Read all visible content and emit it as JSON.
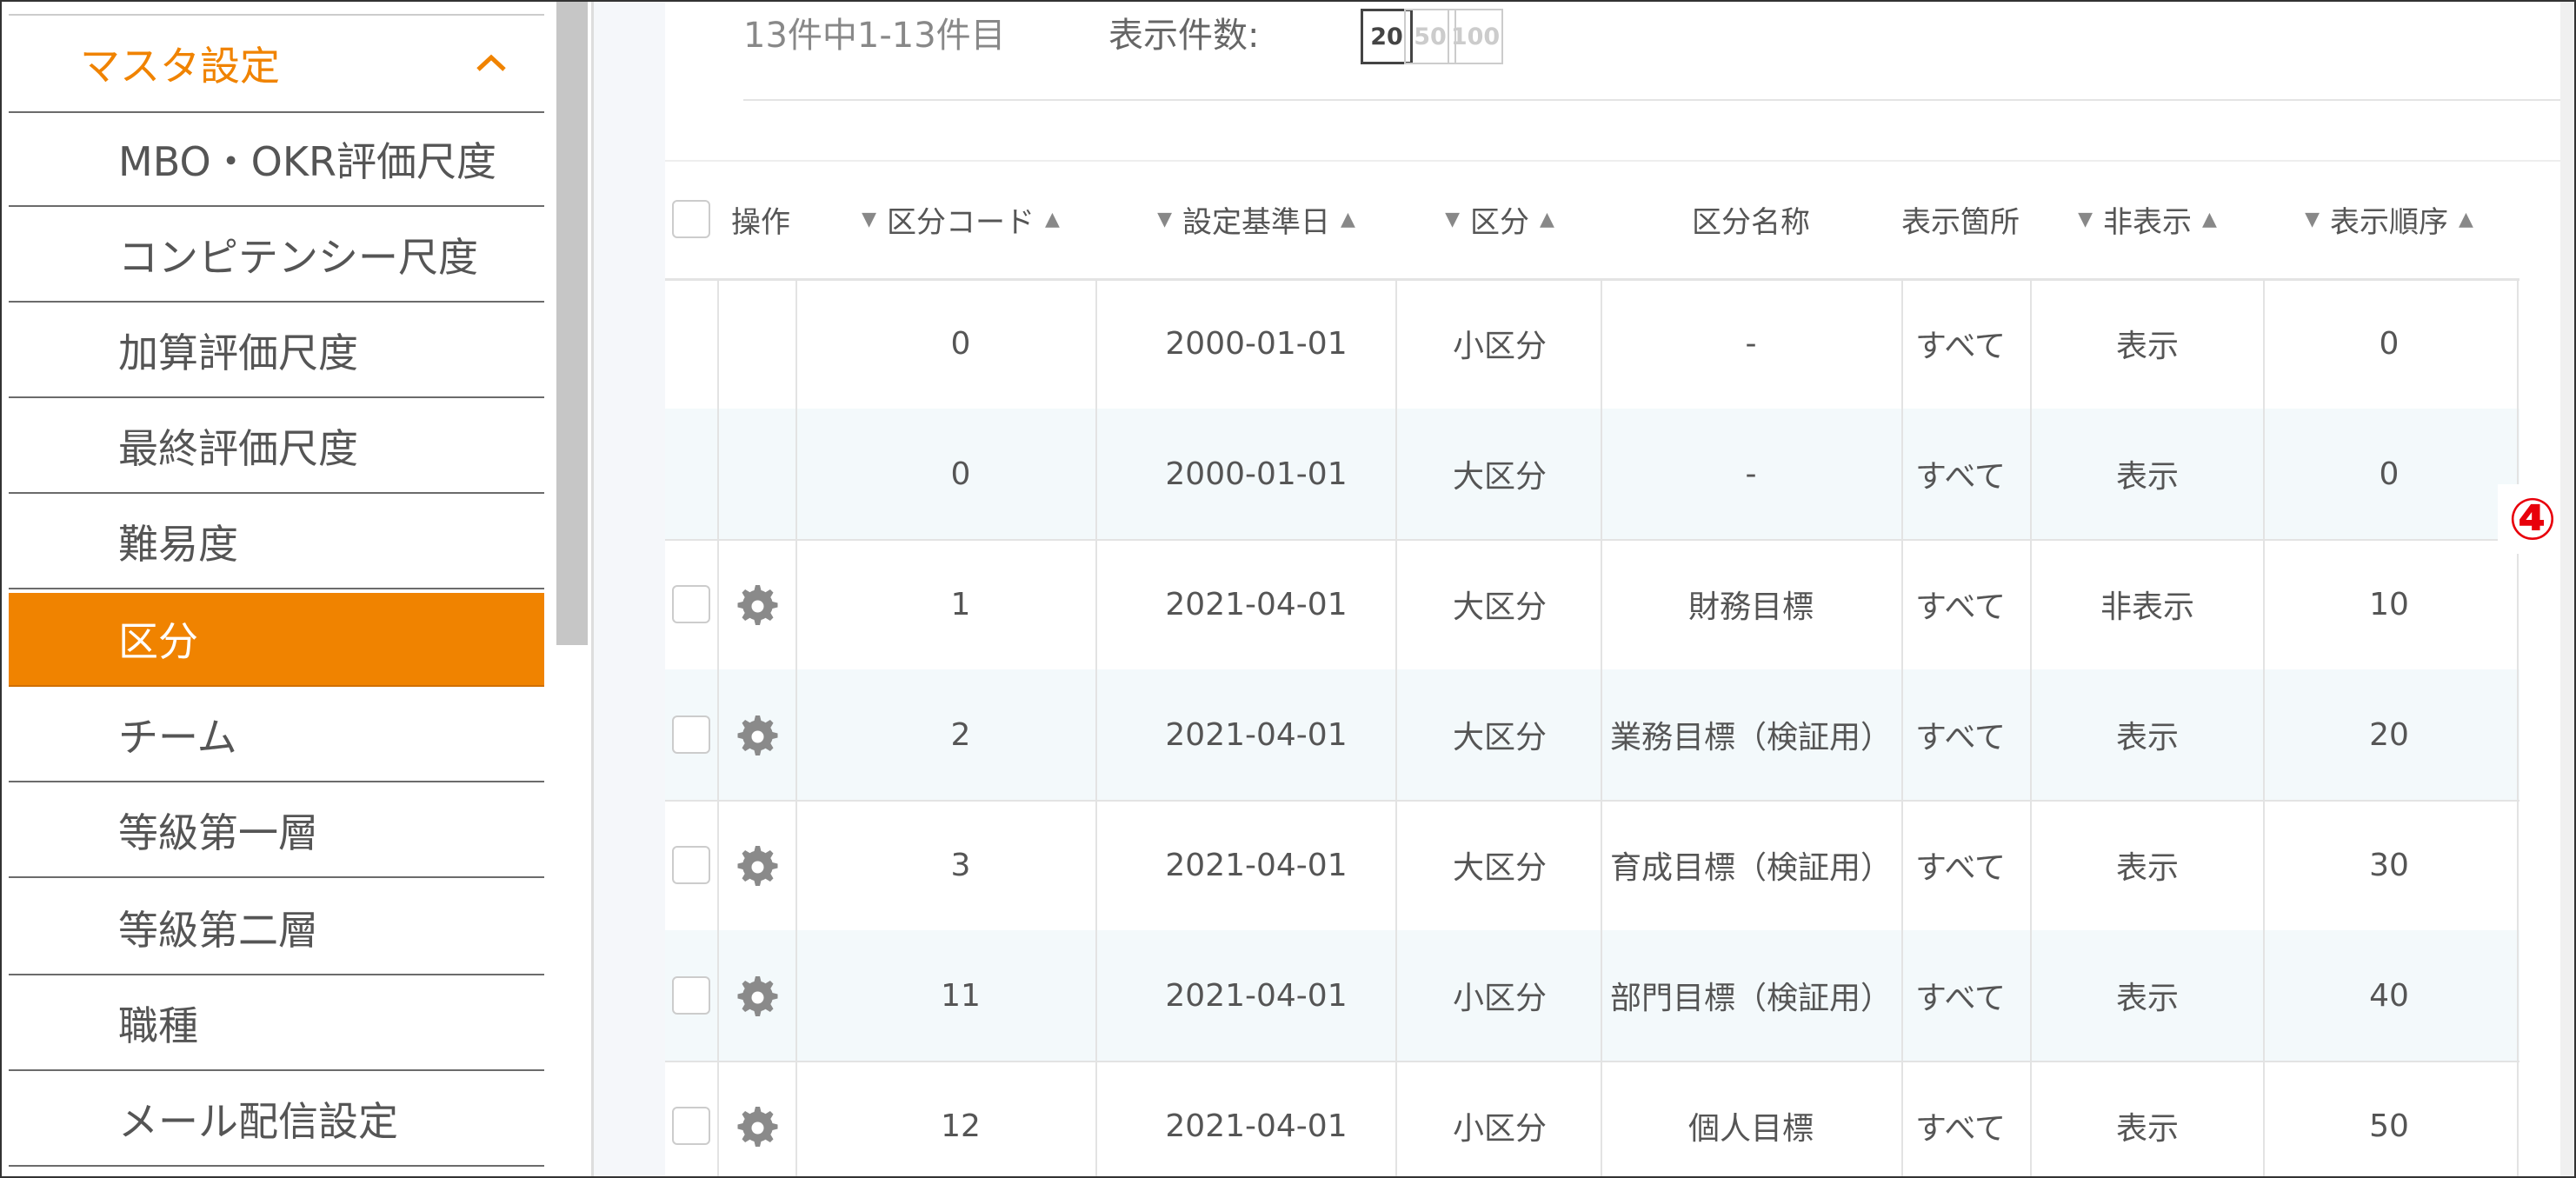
{
  "sidebar": {
    "header": "マスタ設定",
    "items": [
      {
        "label": "MBO・OKR評価尺度"
      },
      {
        "label": "コンピテンシー尺度"
      },
      {
        "label": "加算評価尺度"
      },
      {
        "label": "最終評価尺度"
      },
      {
        "label": "難易度"
      },
      {
        "label": "区分",
        "active": true
      },
      {
        "label": "チーム"
      },
      {
        "label": "等級第一層"
      },
      {
        "label": "等級第二層"
      },
      {
        "label": "職種"
      },
      {
        "label": "メール配信設定"
      }
    ]
  },
  "toolbar": {
    "count_text": "13件中1-13件目",
    "per_page_label": "表示件数:",
    "per_page_options": [
      "20",
      "50",
      "100"
    ],
    "per_page_selected": "20"
  },
  "table": {
    "columns": {
      "action": "操作",
      "code": "区分コード",
      "base_date": "設定基準日",
      "category": "区分",
      "name": "区分名称",
      "location": "表示箇所",
      "hidden": "非表示",
      "order": "表示順序"
    },
    "rows": [
      {
        "code": "0",
        "base_date": "2000-01-01",
        "category": "小区分",
        "name": "-",
        "location": "すべて",
        "hidden": "表示",
        "order": "0"
      },
      {
        "code": "0",
        "base_date": "2000-01-01",
        "category": "大区分",
        "name": "-",
        "location": "すべて",
        "hidden": "表示",
        "order": "0"
      },
      {
        "code": "1",
        "base_date": "2021-04-01",
        "category": "大区分",
        "name": "財務目標",
        "location": "すべて",
        "hidden": "非表示",
        "order": "10"
      },
      {
        "code": "2",
        "base_date": "2021-04-01",
        "category": "大区分",
        "name": "業務目標（検証用）",
        "location": "すべて",
        "hidden": "表示",
        "order": "20"
      },
      {
        "code": "3",
        "base_date": "2021-04-01",
        "category": "大区分",
        "name": "育成目標（検証用）",
        "location": "すべて",
        "hidden": "表示",
        "order": "30"
      },
      {
        "code": "11",
        "base_date": "2021-04-01",
        "category": "小区分",
        "name": "部門目標（検証用）",
        "location": "すべて",
        "hidden": "表示",
        "order": "40"
      },
      {
        "code": "12",
        "base_date": "2021-04-01",
        "category": "小区分",
        "name": "個人目標",
        "location": "すべて",
        "hidden": "表示",
        "order": "50"
      }
    ]
  },
  "annotation": {
    "marker": "④",
    "color": "#e8000b"
  },
  "colors": {
    "accent": "#f08300",
    "highlight": "#e8000b",
    "row_alt": "#f3f9fb"
  }
}
